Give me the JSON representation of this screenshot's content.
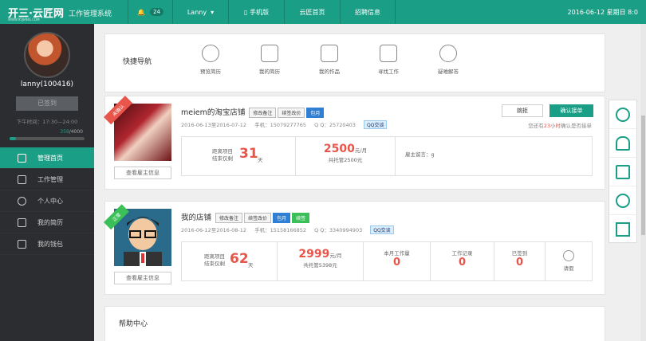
{
  "brand": {
    "name": "开三·云匠网",
    "sub": "WWW.95JIANG.COM",
    "system": "工作管理系统"
  },
  "top": {
    "notif_count": "24",
    "user": "Lanny",
    "links": [
      "手机版",
      "云匠首页",
      "招聘信息"
    ],
    "date": "2016-06-12 星期日 8:0"
  },
  "sidebar": {
    "username": "lanny(100416)",
    "sign_btn": "已签到",
    "shift": "下午时间：17:30—24:00",
    "progress_current": "358",
    "progress_total": "/4000",
    "progress_fraction": 0.0895,
    "menu": [
      "管理首页",
      "工作管理",
      "个人中心",
      "我的简历",
      "我的钱包"
    ]
  },
  "quicknav": {
    "title": "快捷导航",
    "items": [
      "预览简历",
      "我的简历",
      "我的作品",
      "寻找工作",
      "疑难解答"
    ]
  },
  "task1": {
    "ribbon": "未确认",
    "title": "meiem的淘宝店铺",
    "tags": [
      "修改备注",
      "续签改价"
    ],
    "tag_blue": "包月",
    "dates": "2016-06-13至2016-07-12",
    "phone": "手机：15079277765",
    "qq": "Q Q：25720403",
    "qq_btn": "QQ交谈",
    "btn_view": "查看雇主信息",
    "btn_reject": "婉拒",
    "btn_confirm": "确认接单",
    "remain_pre": "您还有",
    "remain_time": "23小时",
    "remain_post": "确认是否接单",
    "dist_label1": "距离项目",
    "dist_label2": "结束仅剩",
    "days": "31",
    "days_unit": "天",
    "price": "2500",
    "price_unit": "元/月",
    "escrow": "共托管2500元",
    "msg": "雇主留言：g"
  },
  "task2": {
    "ribbon": "正常",
    "title": "我的店铺",
    "tags": [
      "修改备注",
      "续签改价"
    ],
    "tag_blue": "包月",
    "tag_green": "续签",
    "dates": "2016-06-12至2016-08-12",
    "phone": "手机：15158166852",
    "qq": "Q Q：3340994903",
    "qq_btn": "QQ交谈",
    "btn_view": "查看雇主信息",
    "dist_label1": "距离项目",
    "dist_label2": "结束仅剩",
    "days": "62",
    "days_unit": "天",
    "price": "2999",
    "price_unit": "元/月",
    "escrow": "共托管5398元",
    "stats": [
      {
        "label": "本月工作量",
        "value": "0"
      },
      {
        "label": "工作记录",
        "value": "0"
      },
      {
        "label": "已签到",
        "value": "0"
      }
    ],
    "leave": "请假"
  },
  "help": {
    "title": "帮助中心"
  },
  "colors": {
    "accent": "#1a9f86",
    "red": "#e8554a",
    "blue": "#2f7fd4",
    "green": "#3bbf59"
  }
}
